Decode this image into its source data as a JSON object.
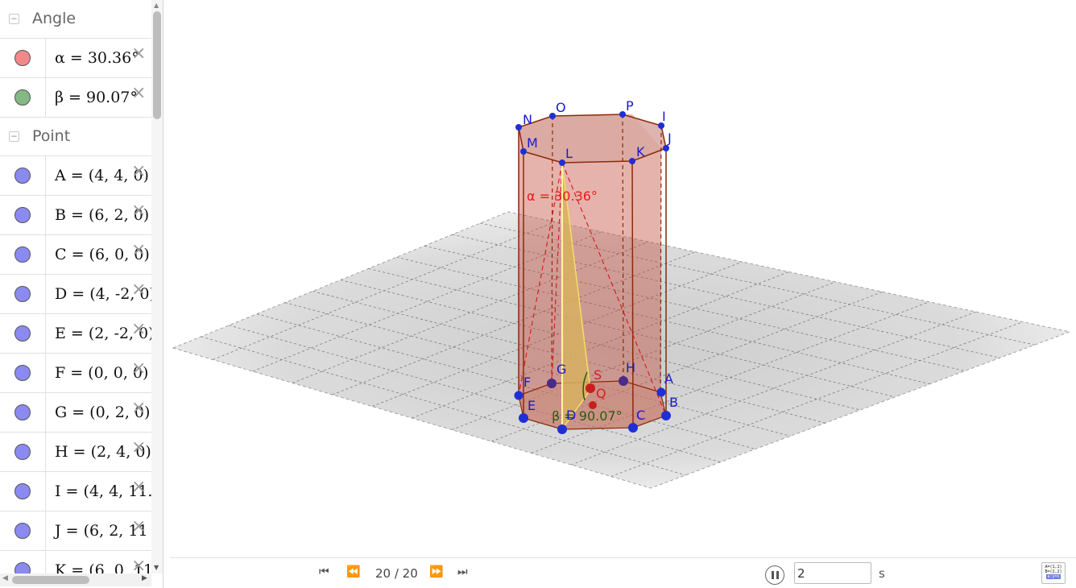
{
  "algebra": {
    "groups": [
      {
        "label": "Angle",
        "rows": [
          {
            "color": "#f08a8a",
            "expr": "α = 30.36°"
          },
          {
            "color": "#84b884",
            "expr": "β = 90.07°"
          }
        ]
      },
      {
        "label": "Point",
        "rows": [
          {
            "color": "#8a8af0",
            "expr": "A = (4, 4, 0)"
          },
          {
            "color": "#8a8af0",
            "expr": "B = (6, 2, 0)"
          },
          {
            "color": "#8a8af0",
            "expr": "C = (6, 0, 0)"
          },
          {
            "color": "#8a8af0",
            "expr": "D = (4, -2, 0)"
          },
          {
            "color": "#8a8af0",
            "expr": "E = (2, -2, 0)"
          },
          {
            "color": "#8a8af0",
            "expr": "F = (0, 0, 0)"
          },
          {
            "color": "#8a8af0",
            "expr": "G = (0, 2, 0)"
          },
          {
            "color": "#8a8af0",
            "expr": "H = (2, 4, 0)"
          },
          {
            "color": "#8a8af0",
            "expr": "I = (4, 4, 11."
          },
          {
            "color": "#8a8af0",
            "expr": "J = (6, 2, 11"
          },
          {
            "color": "#8a8af0",
            "expr": "K = (6, 0, 11"
          }
        ]
      }
    ],
    "collapse_glyph": "−",
    "delete_glyph": "×"
  },
  "graphics": {
    "angle_alpha_label": "α = 30.36°",
    "angle_beta_label": "β = 90.07°",
    "points": {
      "A": "A",
      "B": "B",
      "C": "C",
      "D": "D",
      "E": "E",
      "F": "F",
      "G": "G",
      "H": "H",
      "I": "I",
      "J": "J",
      "K": "K",
      "L": "L",
      "M": "M",
      "N": "N",
      "O": "O",
      "P": "P",
      "Q": "Q",
      "S": "S"
    },
    "colors": {
      "point_blue": "#1e2fd6",
      "label_blue": "#1a1acc",
      "prism_edge": "#8b2a0a",
      "alpha_red": "#e81a1a",
      "beta_green": "#2a5a10"
    }
  },
  "animation": {
    "frame_text": "20 / 20",
    "speed_value": "2",
    "speed_unit": "s",
    "table_icon_lines": [
      "A=(1,1)",
      "B=(2,2)",
      "a:y=x"
    ]
  }
}
